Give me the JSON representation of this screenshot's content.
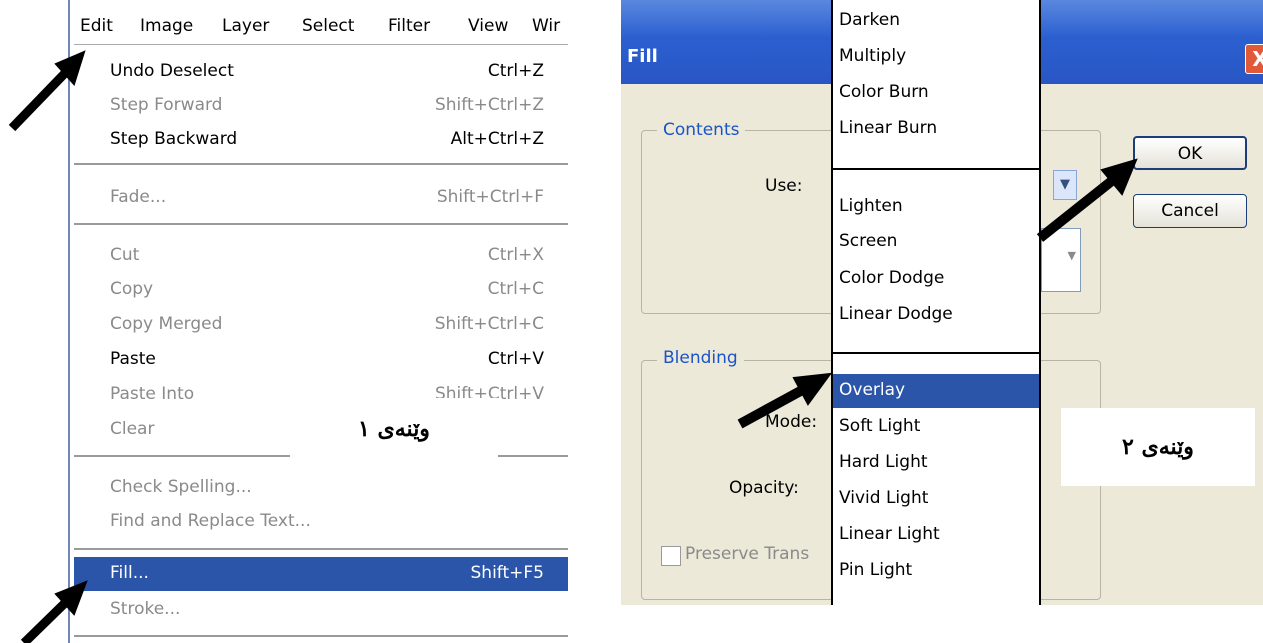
{
  "left": {
    "menubar": [
      "Edit",
      "Image",
      "Layer",
      "Select",
      "Filter",
      "View",
      "Wir"
    ],
    "items": [
      {
        "label": "Undo Deselect",
        "shortcut": "Ctrl+Z",
        "disabled": false
      },
      {
        "label": "Step Forward",
        "shortcut": "Shift+Ctrl+Z",
        "disabled": true
      },
      {
        "label": "Step Backward",
        "shortcut": "Alt+Ctrl+Z",
        "disabled": false
      },
      {
        "label": "Fade...",
        "shortcut": "Shift+Ctrl+F",
        "disabled": true
      },
      {
        "label": "Cut",
        "shortcut": "Ctrl+X",
        "disabled": true
      },
      {
        "label": "Copy",
        "shortcut": "Ctrl+C",
        "disabled": true
      },
      {
        "label": "Copy Merged",
        "shortcut": "Shift+Ctrl+C",
        "disabled": true
      },
      {
        "label": "Paste",
        "shortcut": "Ctrl+V",
        "disabled": false
      },
      {
        "label": "Paste Into",
        "shortcut": "Shift+Ctrl+V",
        "disabled": true
      },
      {
        "label": "Clear",
        "shortcut": "",
        "disabled": true
      },
      {
        "label": "Check Spelling...",
        "shortcut": "",
        "disabled": true
      },
      {
        "label": "Find and Replace Text...",
        "shortcut": "",
        "disabled": true
      },
      {
        "label": "Fill...",
        "shortcut": "Shift+F5",
        "disabled": false,
        "selected": true
      },
      {
        "label": "Stroke...",
        "shortcut": "",
        "disabled": true
      }
    ],
    "caption": "وێنەی ١"
  },
  "right": {
    "title": "Fill",
    "close": "X",
    "contents_legend": "Contents",
    "use_label": "Use:",
    "blending_legend": "Blending",
    "mode_label": "Mode:",
    "opacity_label": "Opacity:",
    "preserve_label": "Preserve Trans",
    "ok": "OK",
    "cancel": "Cancel",
    "caption": "وێنەی ٢",
    "blend_groups": [
      [
        "Darken",
        "Multiply",
        "Color Burn",
        "Linear Burn"
      ],
      [
        "Lighten",
        "Screen",
        "Color Dodge",
        "Linear Dodge"
      ],
      [
        "Overlay",
        "Soft Light",
        "Hard Light",
        "Vivid Light",
        "Linear Light",
        "Pin Light"
      ]
    ],
    "selected_mode": "Overlay"
  },
  "colors": {
    "selection": "#2b55a8",
    "titlebar": "#2b5fd0",
    "dialog_bg": "#ece9d8",
    "disabled_text": "#8a8a8a"
  }
}
